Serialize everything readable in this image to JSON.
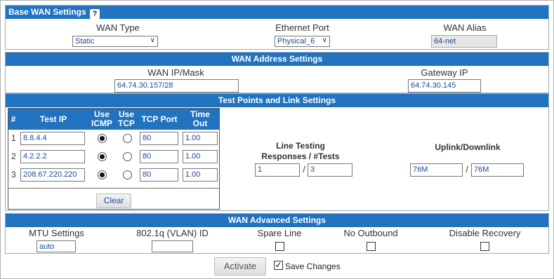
{
  "base_wan": {
    "title": "Base WAN Settings",
    "help_icon": "?",
    "wan_type_label": "WAN Type",
    "wan_type_value": "Static",
    "ethernet_port_label": "Ethernet Port",
    "ethernet_port_value": "Physical_6",
    "wan_alias_label": "WAN Alias",
    "wan_alias_value": "64-net"
  },
  "wan_address": {
    "title": "WAN Address Settings",
    "ip_mask_label": "WAN IP/Mask",
    "ip_mask_value": "64.74.30.157/28",
    "gateway_label": "Gateway IP",
    "gateway_value": "64.74.30.145"
  },
  "test_points": {
    "title": "Test Points and Link Settings",
    "headers": {
      "num": "#",
      "test_ip": "Test IP",
      "use_icmp_1": "Use",
      "use_icmp_2": "ICMP",
      "use_tcp_1": "Use",
      "use_tcp_2": "TCP",
      "tcp_port": "TCP Port",
      "timeout_1": "Time",
      "timeout_2": "Out"
    },
    "rows": [
      {
        "num": "1",
        "ip": "8.8.4.4",
        "icmp": true,
        "tcp": false,
        "port": "80",
        "timeout": "1.00"
      },
      {
        "num": "2",
        "ip": "4.2.2.2",
        "icmp": true,
        "tcp": false,
        "port": "80",
        "timeout": "1.00"
      },
      {
        "num": "3",
        "ip": "208.67.220.220",
        "icmp": true,
        "tcp": false,
        "port": "80",
        "timeout": "1.00"
      }
    ],
    "clear_label": "Clear",
    "line_testing_label_1": "Line Testing",
    "line_testing_label_2": "Responses / #Tests",
    "responses_value": "1",
    "tests_value": "3",
    "slash": "/",
    "uplink_label": "Uplink/Downlink",
    "uplink_value": "76M",
    "downlink_value": "76M"
  },
  "advanced": {
    "title": "WAN Advanced Settings",
    "mtu_label": "MTU Settings",
    "mtu_value": "auto",
    "vlan_label": "802.1q (VLAN) ID",
    "vlan_value": "",
    "spare_label": "Spare Line",
    "no_outbound_label": "No Outbound",
    "disable_recovery_label": "Disable Recovery"
  },
  "footer": {
    "activate_label": "Activate",
    "save_changes_label": "Save Changes",
    "save_changes_checked": true,
    "check_glyph": "✓"
  },
  "colors": {
    "section_bar": "#2173bf",
    "input_text": "#1a4b9a"
  }
}
